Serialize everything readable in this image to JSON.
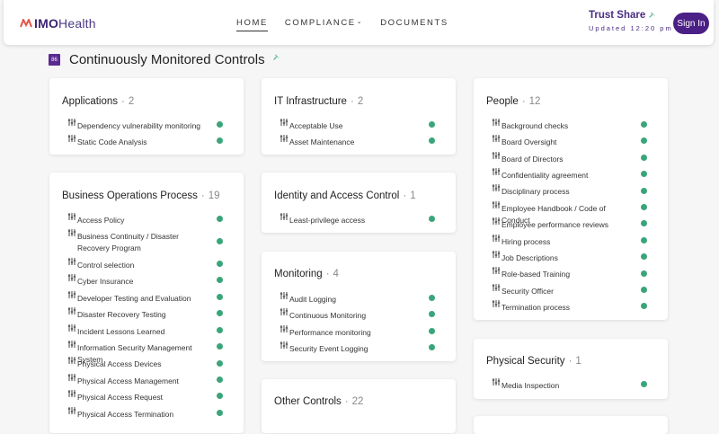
{
  "header": {
    "logo_prefix": "IMO",
    "logo_suffix": "Health",
    "nav": [
      {
        "label": "HOME",
        "active": true
      },
      {
        "label": "COMPLIANCE",
        "has_dropdown": true
      },
      {
        "label": "DOCUMENTS"
      }
    ],
    "trust_title": "Trust Share",
    "trust_updated": "Updated 12:20 pm",
    "sign_in": "Sign In"
  },
  "section": {
    "badge": "86",
    "title": "Continuously Monitored Controls"
  },
  "colors": {
    "brand": "#4a1f86",
    "status_ok": "#3aa57a",
    "background": "#f6f6f6"
  },
  "item_icon": "sliders-icon",
  "cards": {
    "applications": {
      "title": "Applications",
      "count": "2",
      "items": [
        "Dependency vulnerability monitoring",
        "Static Code Analysis"
      ]
    },
    "it_infrastructure": {
      "title": "IT Infrastructure",
      "count": "2",
      "items": [
        "Acceptable Use",
        "Asset Maintenance"
      ]
    },
    "people": {
      "title": "People",
      "count": "12",
      "items": [
        "Background checks",
        "Board Oversight",
        "Board of Directors",
        "Confidentiality agreement",
        "Disciplinary process",
        "Employee Handbook / Code of Conduct",
        "Employee performance reviews",
        "Hiring process",
        "Job Descriptions",
        "Role-based Training",
        "Security Officer",
        "Termination process"
      ]
    },
    "business_operations": {
      "title": "Business Operations Process",
      "count": "19",
      "items": [
        "Access Policy",
        "Business Continuity / Disaster Recovery Program",
        "Control selection",
        "Cyber Insurance",
        "Developer Testing and Evaluation",
        "Disaster Recovery Testing",
        "Incident Lessons Learned",
        "Information Security Management System",
        "Physical Access Devices",
        "Physical Access Management",
        "Physical Access Request",
        "Physical Access Termination"
      ]
    },
    "identity_access": {
      "title": "Identity and Access Control",
      "count": "1",
      "items": [
        "Least-privilege access"
      ]
    },
    "monitoring": {
      "title": "Monitoring",
      "count": "4",
      "items": [
        "Audit Logging",
        "Continuous Monitoring",
        "Performance monitoring",
        "Security Event Logging"
      ]
    },
    "physical_security": {
      "title": "Physical Security",
      "count": "1",
      "items": [
        "Media Inspection"
      ]
    },
    "other_controls": {
      "title": "Other Controls",
      "count": "22",
      "items": []
    }
  }
}
